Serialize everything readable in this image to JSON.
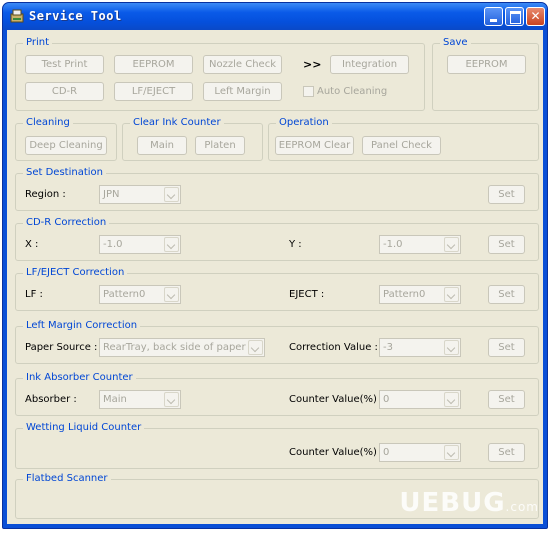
{
  "window": {
    "title": "Service Tool"
  },
  "print": {
    "legend": "Print",
    "test_print": "Test Print",
    "eeprom": "EEPROM",
    "nozzle_check": "Nozzle Check",
    "arrows": ">>",
    "integration": "Integration",
    "cd_r": "CD-R",
    "lf_eject": "LF/EJECT",
    "left_margin": "Left Margin",
    "auto_cleaning": "Auto Cleaning"
  },
  "save": {
    "legend": "Save",
    "eeprom": "EEPROM"
  },
  "cleaning": {
    "legend": "Cleaning",
    "deep_cleaning": "Deep Cleaning"
  },
  "ink_counter": {
    "legend": "Clear Ink Counter",
    "main": "Main",
    "platen": "Platen"
  },
  "operation": {
    "legend": "Operation",
    "eeprom_clear": "EEPROM Clear",
    "panel_check": "Panel Check"
  },
  "destination": {
    "legend": "Set Destination",
    "region_label": "Region :",
    "region_value": "JPN",
    "set": "Set"
  },
  "cdr_correction": {
    "legend": "CD-R Correction",
    "x_label": "X :",
    "x_value": "-1.0",
    "y_label": "Y :",
    "y_value": "-1.0",
    "set": "Set"
  },
  "lf_correction": {
    "legend": "LF/EJECT Correction",
    "lf_label": "LF :",
    "lf_value": "Pattern0",
    "eject_label": "EJECT :",
    "eject_value": "Pattern0",
    "set": "Set"
  },
  "left_margin": {
    "legend": "Left Margin Correction",
    "source_label": "Paper Source :",
    "source_value": "RearTray, back side of paper",
    "corr_label": "Correction Value :",
    "corr_value": "-3",
    "set": "Set"
  },
  "absorber": {
    "legend": "Ink Absorber Counter",
    "absorber_label": "Absorber :",
    "absorber_value": "Main",
    "counter_label": "Counter Value(%) :",
    "counter_value": "0",
    "set": "Set"
  },
  "wetting": {
    "legend": "Wetting Liquid Counter",
    "counter_label": "Counter Value(%) :",
    "counter_value": "0",
    "set": "Set"
  },
  "scanner": {
    "legend": "Flatbed Scanner"
  },
  "watermark": {
    "main": "UEBUG",
    "tld": ".com"
  }
}
